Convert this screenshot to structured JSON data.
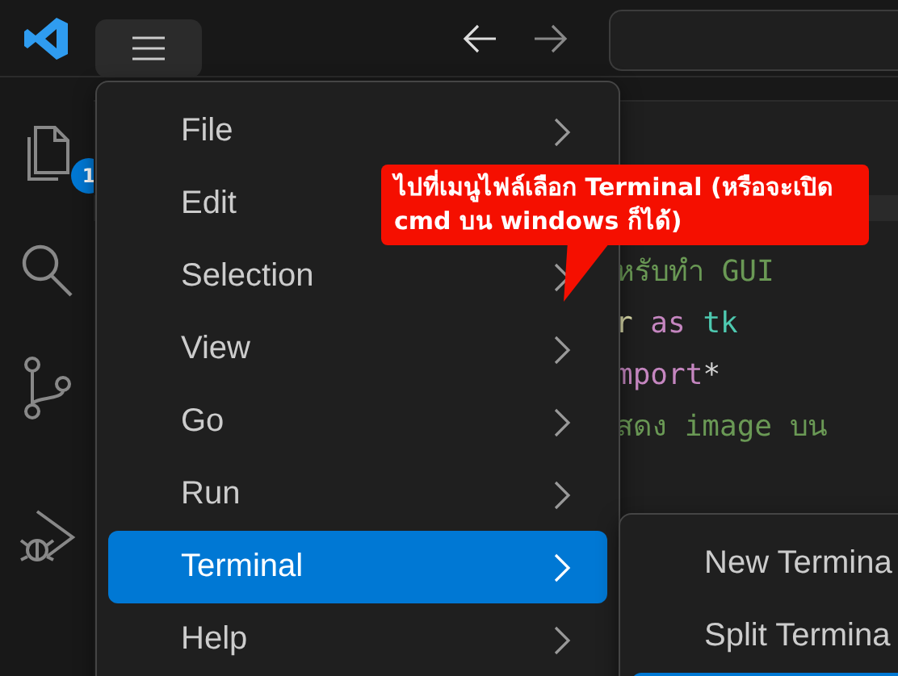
{
  "activity_bar": {
    "files_badge": "1"
  },
  "menu": {
    "items": [
      {
        "label": "File",
        "selected": false,
        "submenu": true
      },
      {
        "label": "Edit",
        "selected": false
      },
      {
        "label": "Selection",
        "selected": false,
        "submenu": true
      },
      {
        "label": "View",
        "selected": false,
        "submenu": true
      },
      {
        "label": "Go",
        "selected": false,
        "submenu": true
      },
      {
        "label": "Run",
        "selected": false,
        "submenu": true
      },
      {
        "label": "Terminal",
        "selected": true,
        "submenu": true
      },
      {
        "label": "Help",
        "selected": false,
        "submenu": true
      }
    ]
  },
  "submenu": {
    "items": [
      {
        "label": "New Termina",
        "selected": false
      },
      {
        "label": "Split Termina",
        "selected": false
      },
      {
        "selected": true
      }
    ]
  },
  "code_lines": [
    [
      {
        "kind": "comment",
        "text": "หรับทำ GUI"
      }
    ],
    [
      {
        "kind": "name",
        "text": "r"
      },
      {
        "kind": "keyword",
        "text": " as"
      },
      {
        "kind": "module",
        "text": " tk"
      }
    ],
    [
      {
        "kind": "keyword",
        "text": "mport"
      },
      {
        "kind": "plain",
        "text": "*"
      }
    ],
    [
      {
        "kind": "comment",
        "text": "สดง image บน"
      }
    ]
  ],
  "callout": {
    "text": "ไปที่เมนูไฟล์เลือก Terminal (หรือจะเปิด cmd บน windows ก็ได้)"
  }
}
